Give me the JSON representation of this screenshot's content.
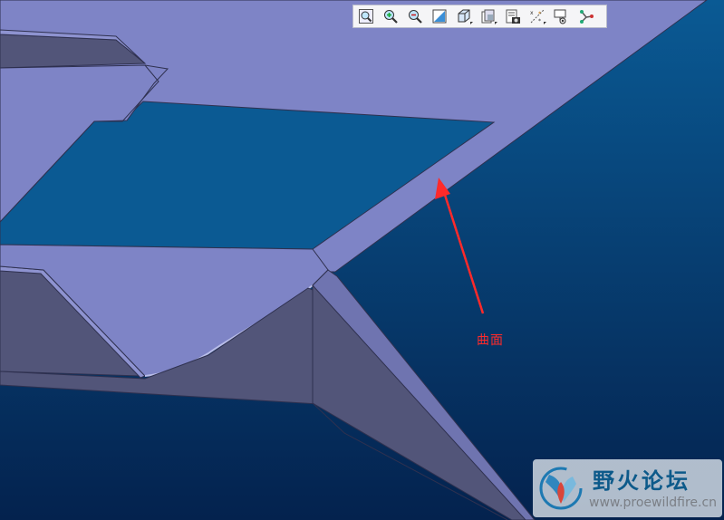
{
  "toolbar": {
    "buttons": [
      {
        "icon": "zoom-fit-icon",
        "label": "Refit"
      },
      {
        "icon": "zoom-in-icon",
        "label": "Zoom In"
      },
      {
        "icon": "zoom-out-icon",
        "label": "Zoom Out"
      },
      {
        "icon": "repaint-icon",
        "label": "Repaint"
      },
      {
        "icon": "display-style-icon",
        "label": "Display Style"
      },
      {
        "icon": "saved-views-icon",
        "label": "Saved Orientations"
      },
      {
        "icon": "view-manager-icon",
        "label": "View Manager"
      },
      {
        "icon": "datum-display-icon",
        "label": "Datum Display"
      },
      {
        "icon": "annotation-display-icon",
        "label": "Annotation Display"
      },
      {
        "icon": "spin-center-icon",
        "label": "Spin Center"
      }
    ]
  },
  "annotation": {
    "label": "曲面",
    "color": "#ff2a2a"
  },
  "watermark": {
    "title": "野火论坛",
    "url": "www.proewildfire.cn"
  },
  "colors": {
    "background_top": "#0a5a94",
    "background_bottom": "#04224e",
    "surface": "#7e84c6",
    "surface_dark": "#525579",
    "edge": "#2f3150"
  }
}
